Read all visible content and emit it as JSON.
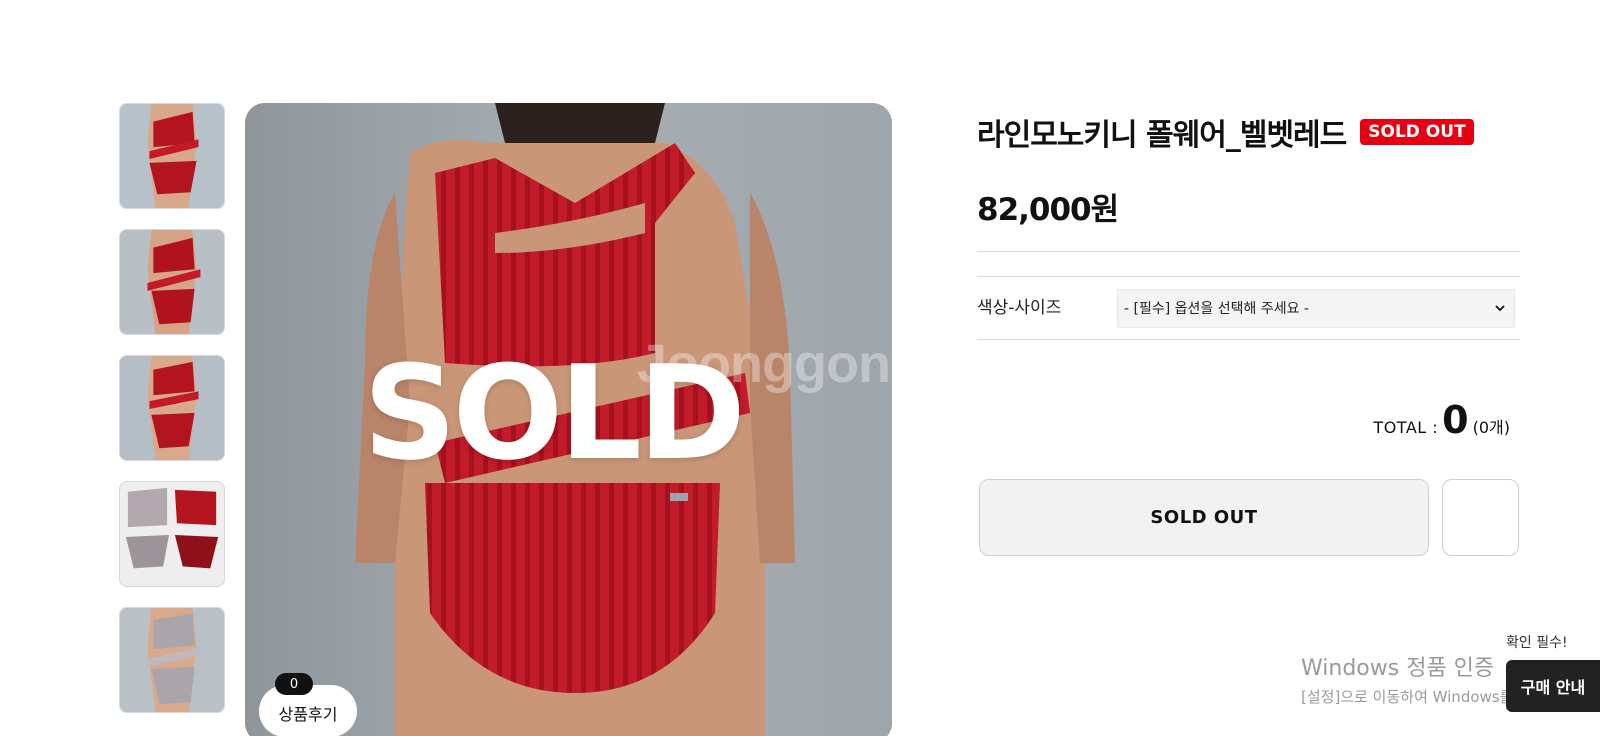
{
  "product": {
    "title": "라인모노키니 폴웨어_벨벳레드",
    "badge": "SOLD OUT",
    "price": "82,000원",
    "accent_color": "#e60012"
  },
  "gallery": {
    "watermark": "Joonggon",
    "overlay_text": "SOLD",
    "review_label": "상품후기",
    "review_count": "0"
  },
  "options": {
    "label": "색상-사이즈",
    "select_value": "- [필수] 옵션을 선택해 주세요 -"
  },
  "total": {
    "label": "TOTAL :",
    "amount": "0",
    "quantity": "(0개)"
  },
  "buttons": {
    "soldout": "SOLD OUT"
  },
  "overlay": {
    "activation_title": "Windows 정품 인증",
    "activation_sub": "[설정]으로 이동하여 Windows를 정품",
    "confirm_tip": "확인 필수!",
    "guide_label": "구매 안내"
  }
}
